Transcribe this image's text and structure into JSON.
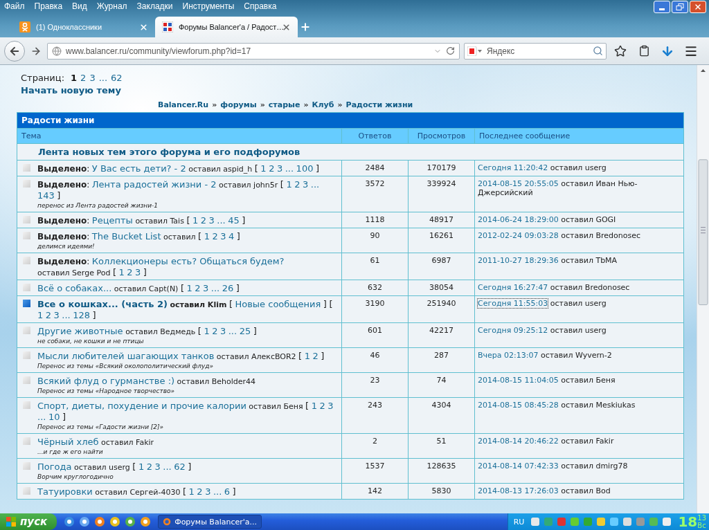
{
  "menu": [
    "Файл",
    "Правка",
    "Вид",
    "Журнал",
    "Закладки",
    "Инструменты",
    "Справка"
  ],
  "tabs": [
    {
      "title": "(1) Одноклассники",
      "kind": "ok",
      "selected": false
    },
    {
      "title": "Форумы Balancer'a / Радост…",
      "kind": "forum",
      "selected": true
    }
  ],
  "address": {
    "url": "www.balancer.ru/community/viewforum.php?id=17"
  },
  "search": {
    "placeholder": "Яндекс"
  },
  "pager": {
    "label": "Страниц:",
    "items": [
      {
        "text": "1",
        "selected": true
      },
      {
        "text": "2",
        "selected": false
      },
      {
        "text": "3",
        "selected": false
      },
      {
        "text": "...",
        "selected": false
      },
      {
        "text": "62",
        "selected": false
      }
    ]
  },
  "new_topic": "Начать новую тему",
  "breadcrumbs": [
    {
      "label": "Balancer.Ru",
      "sep": "»"
    },
    {
      "label": "форумы",
      "sep": "»"
    },
    {
      "label": "старые",
      "sep": "»"
    },
    {
      "label": "Клуб",
      "sep": "»"
    },
    {
      "label": "Радости жизни"
    }
  ],
  "forum_title": "Радости жизни",
  "columns": [
    "Тема",
    "Ответов",
    "Просмотров",
    "Последнее сообщение"
  ],
  "feed": "Лента новых тем этого форума и его подфорумов",
  "rows": [
    {
      "prefix": "**Выделено**:",
      "title": "У Вас есть дети? - 2",
      "author": "оставил aspid_h",
      "pages": {
        "open": "[",
        "links": [
          "1",
          "2",
          "3",
          "...",
          "100"
        ],
        "close": "]"
      },
      "unread": false,
      "replies": "2484",
      "views": "170179",
      "last_time": "Сегодня 11:20:42",
      "last_author": "оставил userg",
      "focused": false
    },
    {
      "prefix": "**Выделено**:",
      "title": "Лента радостей жизни - 2",
      "author": "оставил john5r",
      "pages": {
        "open": "[",
        "links": [
          "1",
          "2",
          "3",
          "...",
          "143"
        ],
        "close": "]"
      },
      "note": "перенос из Лента радостей жизни-1",
      "unread": false,
      "replies": "3572",
      "views": "339924",
      "last_time": "2014-08-15 20:55:05",
      "last_author": "оставил Иван Нью-Джерсийский",
      "focused": false
    },
    {
      "prefix": "**Выделено**:",
      "title": "Рецепты",
      "author": "оставил Tais",
      "pages": {
        "open": "[",
        "links": [
          "1",
          "2",
          "3",
          "...",
          "45"
        ],
        "close": "]"
      },
      "unread": false,
      "replies": "1118",
      "views": "48917",
      "last_time": "2014-06-24 18:29:00",
      "last_author": "оставил GOGI",
      "focused": false
    },
    {
      "prefix": "**Выделено**:",
      "title": "The Bucket List",
      "author": "оставил",
      "pages": {
        "open": "[",
        "links": [
          "1",
          "2",
          "3",
          "4"
        ],
        "close": "]"
      },
      "note": "делимся идеями!",
      "unread": false,
      "replies": "90",
      "views": "16261",
      "last_time": "2012-02-24 09:03:28",
      "last_author": "оставил Bredonosec",
      "focused": false
    },
    {
      "prefix": "**Выделено**:",
      "title": "Коллекционеры есть? Общаться будем?",
      "author": "оставил Serge Pod",
      "pages": {
        "open": "[",
        "links": [
          "1",
          "2",
          "3"
        ],
        "close": "]"
      },
      "unread": false,
      "replies": "61",
      "views": "6987",
      "last_time": "2011-10-27 18:29:36",
      "last_author": "оставил TbMA",
      "focused": false
    },
    {
      "title": "Всё о собаках...",
      "author": "оставил Capt(N)",
      "pages": {
        "open": "[",
        "links": [
          "1",
          "2",
          "3",
          "...",
          "26"
        ],
        "close": "]"
      },
      "unread": false,
      "replies": "632",
      "views": "38054",
      "last_time": "Сегодня 16:27:47",
      "last_author": "оставил Bredonosec",
      "focused": false
    },
    {
      "title": "Все о кошках... (часть 2)",
      "author": "оставил Klim",
      "new_posts": {
        "open": "[",
        "label": "Новые сообщения",
        "close": "]"
      },
      "pages": {
        "open": "[",
        "links": [
          "1",
          "2",
          "3",
          "...",
          "128"
        ],
        "close": "]"
      },
      "unread": true,
      "replies": "3190",
      "views": "251940",
      "last_time": "Сегодня 11:55:03",
      "last_author": "оставил userg",
      "focused": true
    },
    {
      "title": "Другие животные",
      "author": "оставил Ведмедь",
      "pages": {
        "open": "[",
        "links": [
          "1",
          "2",
          "3",
          "...",
          "25"
        ],
        "close": "]"
      },
      "note": "не собаки, не кошки и не птицы",
      "unread": false,
      "replies": "601",
      "views": "42217",
      "last_time": "Сегодня 09:25:12",
      "last_author": "оставил userg",
      "focused": false
    },
    {
      "title": "Мысли любителей шагающих танков",
      "author": "оставил АлексBOR2",
      "pages": {
        "open": "[",
        "links": [
          "1",
          "2"
        ],
        "close": "]"
      },
      "note": "Перенос из темы «Всякий околополитический флуд»",
      "unread": false,
      "replies": "46",
      "views": "287",
      "last_time": "Вчера 02:13:07",
      "last_author": "оставил Wyvern-2",
      "focused": false
    },
    {
      "title": "Всякий флуд о гурманстве :)",
      "author": "оставил Beholder44",
      "note": "Перенос из темы «Народное творчество»",
      "unread": false,
      "replies": "23",
      "views": "74",
      "last_time": "2014-08-15 11:04:05",
      "last_author": "оставил Беня",
      "focused": false
    },
    {
      "title": "Спорт, диеты, похудение и прочие калории",
      "author": "оставил Беня",
      "pages": {
        "open": "[",
        "links": [
          "1",
          "2",
          "3",
          "...",
          "10"
        ],
        "close": "]"
      },
      "note": "Перенос из темы «Гадости жизни [2]»",
      "unread": false,
      "replies": "243",
      "views": "4304",
      "last_time": "2014-08-15 08:45:28",
      "last_author": "оставил Meskiukas",
      "focused": false
    },
    {
      "title": "Чёрный хлеб",
      "author": "оставил Fakir",
      "note": "...и где ж его найти",
      "unread": false,
      "replies": "2",
      "views": "51",
      "last_time": "2014-08-14 20:46:22",
      "last_author": "оставил Fakir",
      "focused": false
    },
    {
      "title": "Погода",
      "author": "оставил userg",
      "pages": {
        "open": "[",
        "links": [
          "1",
          "2",
          "3",
          "...",
          "62"
        ],
        "close": "]"
      },
      "note": "Ворчим круглогодично",
      "unread": false,
      "replies": "1537",
      "views": "128635",
      "last_time": "2014-08-14 07:42:33",
      "last_author": "оставил dmirg78",
      "focused": false
    },
    {
      "title": "Татуировки",
      "author": "оставил Сергей-4030",
      "pages": {
        "open": "[",
        "links": [
          "1",
          "2",
          "3",
          "...",
          "6"
        ],
        "close": "]"
      },
      "unread": false,
      "replies": "142",
      "views": "5830",
      "last_time": "2014-08-13 17:26:03",
      "last_author": "оставил Bod",
      "focused": false
    }
  ],
  "taskbar": {
    "start": "пуск",
    "task": "Форумы Balancer'a...",
    "lang": "RU",
    "clock_hour": "18",
    "clock_min": "13",
    "clock_day": "Вс"
  }
}
